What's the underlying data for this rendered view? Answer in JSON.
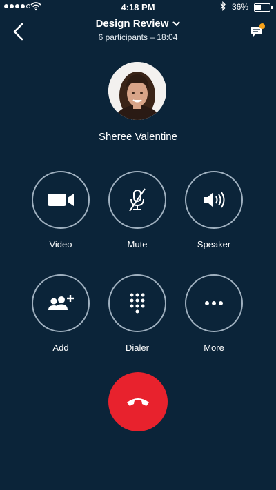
{
  "status_bar": {
    "time": "4:18 PM",
    "battery": "36%",
    "battery_level": 0.36
  },
  "header": {
    "title": "Design Review",
    "subtitle": "6 participants – 18:04",
    "back_icon": "chevron-left-icon",
    "chat_icon": "chat-bubble-icon"
  },
  "caller": {
    "name": "Sheree Valentine"
  },
  "controls": {
    "video": "Video",
    "mute": "Mute",
    "speaker": "Speaker",
    "add": "Add",
    "dialer": "Dialer",
    "more": "More"
  },
  "colors": {
    "background": "#0b2439",
    "end_call": "#e8222d",
    "notification": "#f7a21a"
  }
}
